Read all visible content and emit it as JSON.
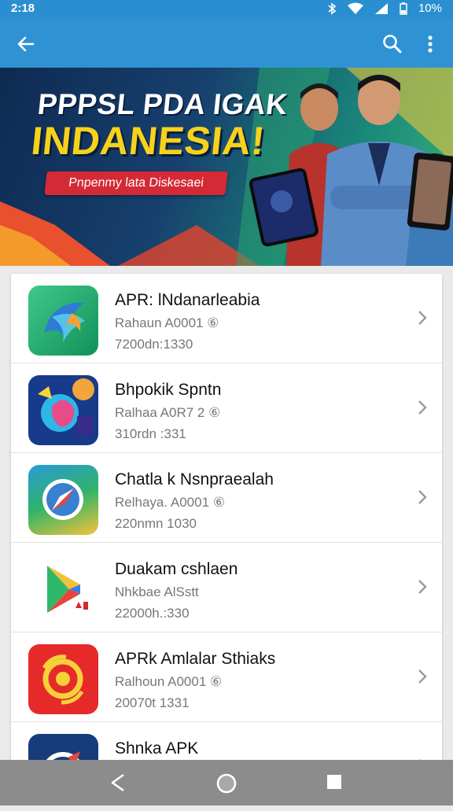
{
  "status_bar": {
    "time": "2:18",
    "battery": "10%",
    "icons": [
      "bluetooth-icon",
      "wifi-icon",
      "signal-icon",
      "battery-icon"
    ]
  },
  "app_bar": {
    "icons": [
      "back-arrow-icon",
      "search-icon",
      "more-vert-icon"
    ],
    "color": "#2f93d3"
  },
  "banner": {
    "line1": "PPPSL PDA IGAK",
    "line2": "INDANESIA!",
    "button": "Pnpenmy lata Diskesaei"
  },
  "apps": [
    {
      "name": "APR: lNdanarleabia",
      "sub": "Rahaun A0001 ⑥",
      "meta": "7200dn:1330",
      "icon": "swirl-app-icon"
    },
    {
      "name": "Bhpokik Spntn",
      "sub": "Ralhaa A0R7 2 ⑥",
      "meta": "310rdn :331",
      "icon": "colorful-blob-app-icon"
    },
    {
      "name": "Chatla k Nsnpraealah",
      "sub": "Relhaya. A0001 ⑥",
      "meta": "220nmn 1030",
      "icon": "compass-app-icon"
    },
    {
      "name": "Duakam cshlaen",
      "sub": "Nhkbae AlSstt",
      "meta": "22000h.:330",
      "icon": "play-store-app-icon"
    },
    {
      "name": "APRk Amlalar Sthiaks",
      "sub": "Ralhoun A0001 ⑥",
      "meta": "20070t 1331",
      "icon": "red-swirl-app-icon"
    },
    {
      "name": "Shnka APK",
      "sub": "",
      "meta": "",
      "icon": "blue-app-icon"
    }
  ],
  "nav_bar": {
    "icons": [
      "back-triangle-icon",
      "home-circle-icon",
      "recents-square-icon"
    ]
  }
}
